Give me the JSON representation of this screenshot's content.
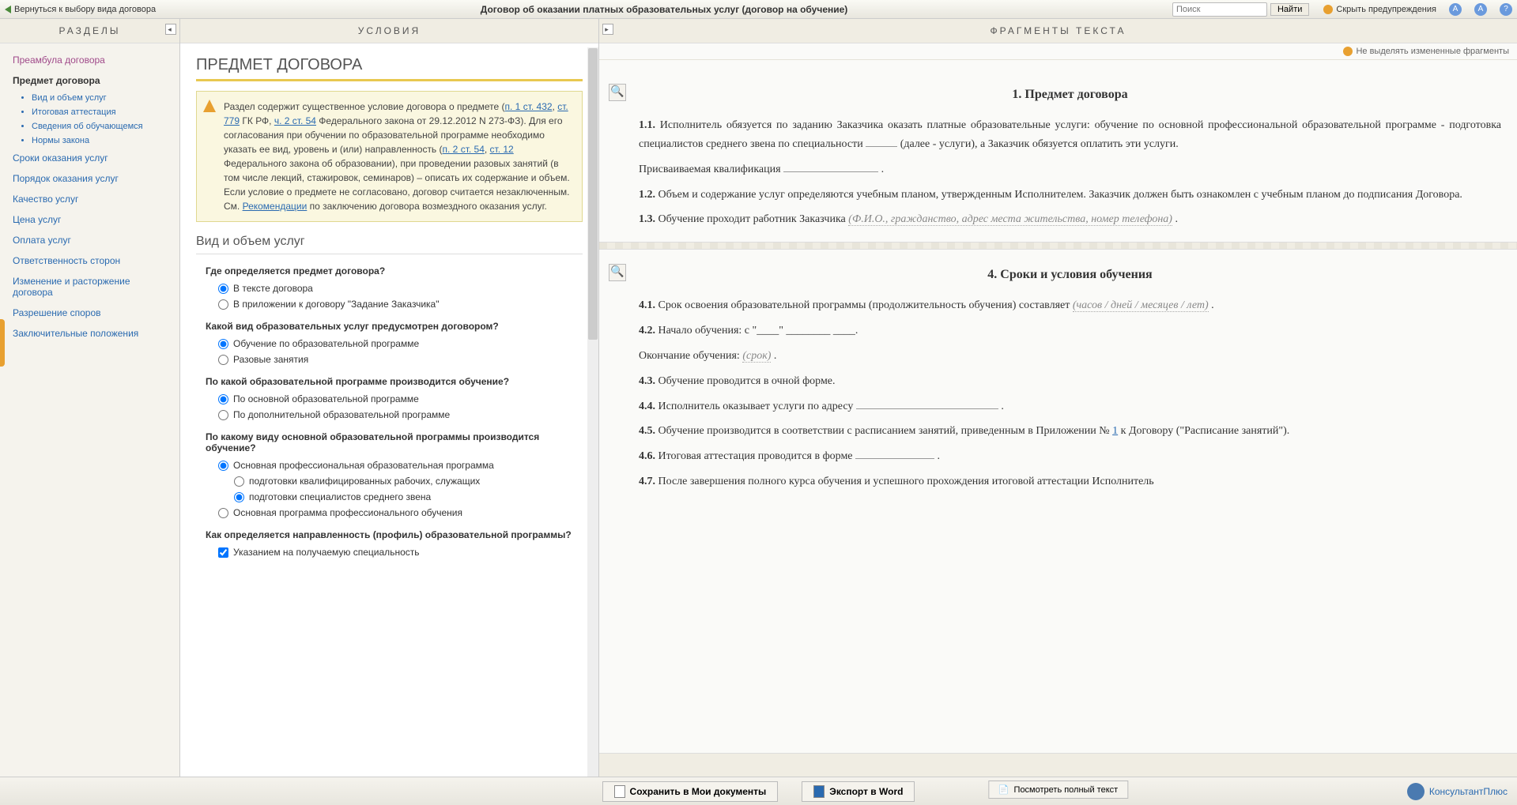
{
  "topbar": {
    "back": "Вернуться к выбору вида договора",
    "title": "Договор об оказании платных образовательных услуг (договор на обучение)",
    "search_placeholder": "Поиск",
    "find": "Найти",
    "hide_warnings": "Скрыть предупреждения"
  },
  "sidebar": {
    "header": "РАЗДЕЛЫ",
    "items": [
      {
        "label": "Преамбула договора",
        "cls": "preamble"
      },
      {
        "label": "Предмет договора",
        "cls": "active"
      },
      {
        "label": "Сроки оказания услуг"
      },
      {
        "label": "Порядок оказания услуг"
      },
      {
        "label": "Качество услуг"
      },
      {
        "label": "Цена услуг"
      },
      {
        "label": "Оплата услуг"
      },
      {
        "label": "Ответственность сторон"
      },
      {
        "label": "Изменение и расторжение договора"
      },
      {
        "label": "Разрешение споров"
      },
      {
        "label": "Заключительные положения"
      }
    ],
    "subs": [
      "Вид и объем услуг",
      "Итоговая аттестация",
      "Сведения об обучающемся",
      "Нормы закона"
    ]
  },
  "center": {
    "header": "УСЛОВИЯ",
    "h1": "ПРЕДМЕТ ДОГОВОРА",
    "info_pre": "Раздел содержит существенное условие договора о предмете (",
    "info_l1": "п. 1 ст. 432",
    "info_l2": "ст. 779",
    "info_m1": " ГК РФ, ",
    "info_l3": "ч. 2 ст. 54",
    "info_m2": " Федерального закона от 29.12.2012 N 273-ФЗ). Для его согласования при обучении по образовательной программе необходимо указать ее вид, уровень и (или) направленность (",
    "info_l4": "п. 2 ст. 54",
    "info_l5": "ст. 12",
    "info_m3": " Федерального закона об образовании), при проведении разовых занятий (в том числе лекций, стажировок, семинаров) – описать их содержание и объем. Если условие о предмете не согласовано, договор считается незаключенным. См. ",
    "info_l6": "Рекомендации",
    "info_post": " по заключению договора возмездного оказания услуг.",
    "h2": "Вид и объем услуг",
    "q1": "Где определяется предмет договора?",
    "q1o1": "В тексте договора",
    "q1o2": "В приложении к договору \"Задание Заказчика\"",
    "q2": "Какой вид образовательных услуг предусмотрен договором?",
    "q2o1": "Обучение по образовательной программе",
    "q2o2": "Разовые занятия",
    "q3": "По какой образовательной программе производится обучение?",
    "q3o1": "По основной образовательной программе",
    "q3o2": "По дополнительной образовательной программе",
    "q4": "По какому виду основной образовательной программы производится обучение?",
    "q4o1": "Основная профессиональная образовательная программа",
    "q4o1a": "подготовки квалифицированных рабочих, служащих",
    "q4o1b": "подготовки специалистов среднего звена",
    "q4o2": "Основная программа профессионального обучения",
    "q5": "Как определяется направленность (профиль) образовательной программы?",
    "q5o1": "Указанием на получаемую специальность"
  },
  "right": {
    "header": "ФРАГМЕНТЫ ТЕКСТА",
    "highlight": "Не выделять измененные фрагменты",
    "sec1_title": "1. Предмет договора",
    "p11": "1.1.",
    "p11_text": " Исполнитель обязуется по заданию Заказчика оказать платные образовательные услуги: обучение по основной профессиональной образовательной программе - подготовка специалистов среднего звена по специальности ",
    "p11_tail": " (далее - услуги), а Заказчик обязуется оплатить эти услуги.",
    "p11b": "Присваиваемая квалификация ",
    "p12": "1.2.",
    "p12_text": " Объем и содержание услуг определяются учебным планом, утвержденным Исполнителем. Заказчик должен быть ознакомлен с учебным планом до подписания Договора.",
    "p13": "1.3.",
    "p13_text": " Обучение проходит работник Заказчика ",
    "p13_hint": "(Ф.И.О., гражданство, адрес места жительства, номер телефона)",
    "sec4_title": "4. Сроки и условия обучения",
    "p41": "4.1.",
    "p41_text": " Срок освоения образовательной программы (продолжительность обучения) составляет ",
    "p41_hint": "(часов / дней / месяцев / лет)",
    "p42": "4.2.",
    "p42_text": " Начало обучения: с \"____\" ________ ____.",
    "p42b": "Окончание обучения: ",
    "p42b_hint": "(срок)",
    "p43": "4.3.",
    "p43_text": " Обучение проводится в очной форме.",
    "p44": "4.4.",
    "p44_text": " Исполнитель оказывает услуги по адресу ",
    "p45": "4.5.",
    "p45_text": " Обучение производится в соответствии с расписанием занятий, приведенным в Приложении № ",
    "p45_link": "1",
    "p45_tail": " к Договору (\"Расписание занятий\").",
    "p46": "4.6.",
    "p46_text": " Итоговая аттестация проводится в форме ",
    "p47": "4.7.",
    "p47_text": " После завершения полного курса обучения и успешного прохождения итоговой аттестации Исполнитель",
    "full_text": "Посмотреть полный текст"
  },
  "bottom": {
    "save": "Сохранить в Мои документы",
    "export": "Экспорт в Word",
    "brand": "КонсультантПлюс"
  }
}
